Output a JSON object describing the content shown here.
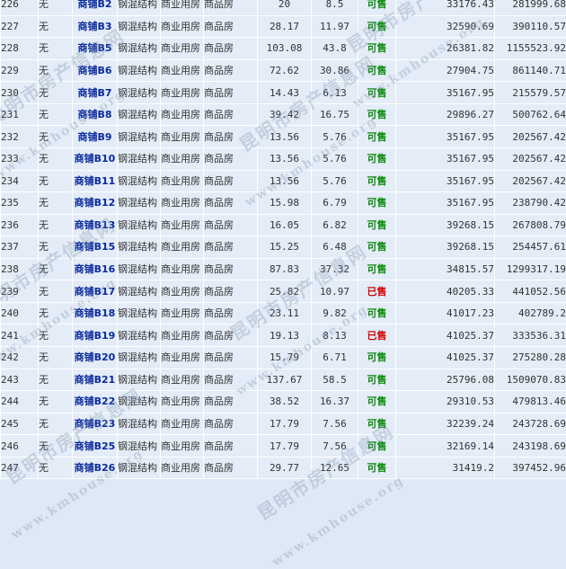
{
  "table": {
    "rows": [
      {
        "no": "226",
        "unit": "无",
        "name": "商铺B2",
        "structure": "钢混结构",
        "use": "商业用房",
        "type": "商品房",
        "area1": "20",
        "area2": "8.5",
        "status": "可售",
        "price": "33176.43",
        "total": "281999.68"
      },
      {
        "no": "227",
        "unit": "无",
        "name": "商铺B3",
        "structure": "钢混结构",
        "use": "商业用房",
        "type": "商品房",
        "area1": "28.17",
        "area2": "11.97",
        "status": "可售",
        "price": "32590.69",
        "total": "390110.57"
      },
      {
        "no": "228",
        "unit": "无",
        "name": "商铺B5",
        "structure": "钢混结构",
        "use": "商业用房",
        "type": "商品房",
        "area1": "103.08",
        "area2": "43.8",
        "status": "可售",
        "price": "26381.82",
        "total": "1155523.92"
      },
      {
        "no": "229",
        "unit": "无",
        "name": "商铺B6",
        "structure": "钢混结构",
        "use": "商业用房",
        "type": "商品房",
        "area1": "72.62",
        "area2": "30.86",
        "status": "可售",
        "price": "27904.75",
        "total": "861140.71"
      },
      {
        "no": "230",
        "unit": "无",
        "name": "商铺B7",
        "structure": "钢混结构",
        "use": "商业用房",
        "type": "商品房",
        "area1": "14.43",
        "area2": "6.13",
        "status": "可售",
        "price": "35167.95",
        "total": "215579.57"
      },
      {
        "no": "231",
        "unit": "无",
        "name": "商铺B8",
        "structure": "钢混结构",
        "use": "商业用房",
        "type": "商品房",
        "area1": "39.42",
        "area2": "16.75",
        "status": "可售",
        "price": "29896.27",
        "total": "500762.64"
      },
      {
        "no": "232",
        "unit": "无",
        "name": "商铺B9",
        "structure": "钢混结构",
        "use": "商业用房",
        "type": "商品房",
        "area1": "13.56",
        "area2": "5.76",
        "status": "可售",
        "price": "35167.95",
        "total": "202567.42"
      },
      {
        "no": "233",
        "unit": "无",
        "name": "商铺B10",
        "structure": "钢混结构",
        "use": "商业用房",
        "type": "商品房",
        "area1": "13.56",
        "area2": "5.76",
        "status": "可售",
        "price": "35167.95",
        "total": "202567.42"
      },
      {
        "no": "234",
        "unit": "无",
        "name": "商铺B11",
        "structure": "钢混结构",
        "use": "商业用房",
        "type": "商品房",
        "area1": "13.56",
        "area2": "5.76",
        "status": "可售",
        "price": "35167.95",
        "total": "202567.42"
      },
      {
        "no": "235",
        "unit": "无",
        "name": "商铺B12",
        "structure": "钢混结构",
        "use": "商业用房",
        "type": "商品房",
        "area1": "15.98",
        "area2": "6.79",
        "status": "可售",
        "price": "35167.95",
        "total": "238790.42"
      },
      {
        "no": "236",
        "unit": "无",
        "name": "商铺B13",
        "structure": "钢混结构",
        "use": "商业用房",
        "type": "商品房",
        "area1": "16.05",
        "area2": "6.82",
        "status": "可售",
        "price": "39268.15",
        "total": "267808.79"
      },
      {
        "no": "237",
        "unit": "无",
        "name": "商铺B15",
        "structure": "钢混结构",
        "use": "商业用房",
        "type": "商品房",
        "area1": "15.25",
        "area2": "6.48",
        "status": "可售",
        "price": "39268.15",
        "total": "254457.61"
      },
      {
        "no": "238",
        "unit": "无",
        "name": "商铺B16",
        "structure": "钢混结构",
        "use": "商业用房",
        "type": "商品房",
        "area1": "87.83",
        "area2": "37.32",
        "status": "可售",
        "price": "34815.57",
        "total": "1299317.19"
      },
      {
        "no": "239",
        "unit": "无",
        "name": "商铺B17",
        "structure": "钢混结构",
        "use": "商业用房",
        "type": "商品房",
        "area1": "25.82",
        "area2": "10.97",
        "status": "已售",
        "price": "40205.33",
        "total": "441052.56"
      },
      {
        "no": "240",
        "unit": "无",
        "name": "商铺B18",
        "structure": "钢混结构",
        "use": "商业用房",
        "type": "商品房",
        "area1": "23.11",
        "area2": "9.82",
        "status": "可售",
        "price": "41017.23",
        "total": "402789.2"
      },
      {
        "no": "241",
        "unit": "无",
        "name": "商铺B19",
        "structure": "钢混结构",
        "use": "商业用房",
        "type": "商品房",
        "area1": "19.13",
        "area2": "8.13",
        "status": "已售",
        "price": "41025.37",
        "total": "333536.31"
      },
      {
        "no": "242",
        "unit": "无",
        "name": "商铺B20",
        "structure": "钢混结构",
        "use": "商业用房",
        "type": "商品房",
        "area1": "15.79",
        "area2": "6.71",
        "status": "可售",
        "price": "41025.37",
        "total": "275280.28"
      },
      {
        "no": "243",
        "unit": "无",
        "name": "商铺B21",
        "structure": "钢混结构",
        "use": "商业用房",
        "type": "商品房",
        "area1": "137.67",
        "area2": "58.5",
        "status": "可售",
        "price": "25796.08",
        "total": "1509070.83"
      },
      {
        "no": "244",
        "unit": "无",
        "name": "商铺B22",
        "structure": "钢混结构",
        "use": "商业用房",
        "type": "商品房",
        "area1": "38.52",
        "area2": "16.37",
        "status": "可售",
        "price": "29310.53",
        "total": "479813.46"
      },
      {
        "no": "245",
        "unit": "无",
        "name": "商铺B23",
        "structure": "钢混结构",
        "use": "商业用房",
        "type": "商品房",
        "area1": "17.79",
        "area2": "7.56",
        "status": "可售",
        "price": "32239.24",
        "total": "243728.69"
      },
      {
        "no": "246",
        "unit": "无",
        "name": "商铺B25",
        "structure": "钢混结构",
        "use": "商业用房",
        "type": "商品房",
        "area1": "17.79",
        "area2": "7.56",
        "status": "可售",
        "price": "32169.14",
        "total": "243198.69"
      },
      {
        "no": "247",
        "unit": "无",
        "name": "商铺B26",
        "structure": "钢混结构",
        "use": "商业用房",
        "type": "商品房",
        "area1": "29.77",
        "area2": "12.65",
        "status": "可售",
        "price": "31419.2",
        "total": "397452.96"
      }
    ]
  },
  "watermark": {
    "text_cn": "昆明市房产信息网",
    "text_url": "www.kmhouse.org"
  },
  "colors": {
    "status_for_sale": "#0a8a0a",
    "status_sold": "#d40000",
    "unit_name": "#0a2a9c",
    "cell_bg": "#e3ecf7"
  }
}
